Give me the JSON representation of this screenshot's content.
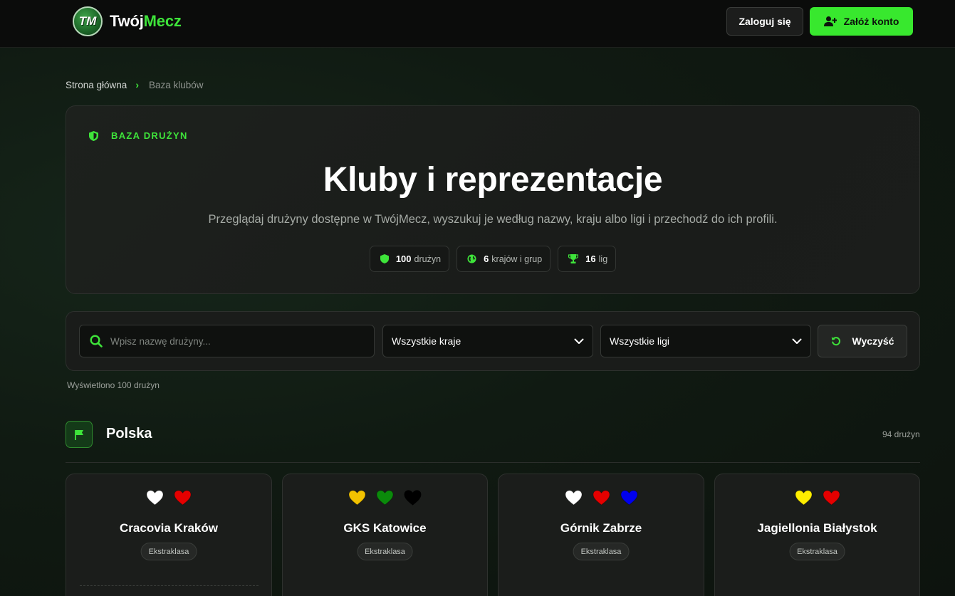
{
  "header": {
    "logo_badge": "TM",
    "logo_text_white": "Twój",
    "logo_text_green": "Mecz",
    "login_label": "Zaloguj się",
    "signup_label": "Załóż konto"
  },
  "breadcrumb": {
    "home": "Strona główna",
    "current": "Baza klubów"
  },
  "hero": {
    "tag": "BAZA DRUŻYN",
    "title": "Kluby i reprezentacje",
    "subtitle": "Przeglądaj drużyny dostępne w TwójMecz, wyszukuj je według nazwy, kraju albo ligi i przechodź do ich profili.",
    "stats": [
      {
        "value": "100",
        "label": "drużyn",
        "icon": "shield-icon"
      },
      {
        "value": "6",
        "label": "krajów i grup",
        "icon": "globe-icon"
      },
      {
        "value": "16",
        "label": "lig",
        "icon": "trophy-icon"
      }
    ]
  },
  "filters": {
    "search_placeholder": "Wpisz nazwę drużyny...",
    "country_selected": "Wszystkie kraje",
    "league_selected": "Wszystkie ligi",
    "clear_label": "Wyczyść"
  },
  "results_count": "Wyświetlono 100 drużyn",
  "section": {
    "title": "Polska",
    "count": "94 drużyn"
  },
  "colors": {
    "accent": "#3ee43a",
    "background": "#0f160f"
  },
  "teams": [
    {
      "name": "Cracovia Kraków",
      "league": "Ekstraklasa",
      "colors": [
        "#ffffff",
        "#e50000"
      ]
    },
    {
      "name": "GKS Katowice",
      "league": "Ekstraklasa",
      "colors": [
        "#f2c200",
        "#0b8a0b",
        "#000000"
      ]
    },
    {
      "name": "Górnik Zabrze",
      "league": "Ekstraklasa",
      "colors": [
        "#ffffff",
        "#e50000",
        "#0000ee"
      ]
    },
    {
      "name": "Jagiellonia Białystok",
      "league": "Ekstraklasa",
      "colors": [
        "#ffee00",
        "#e50000"
      ]
    }
  ]
}
